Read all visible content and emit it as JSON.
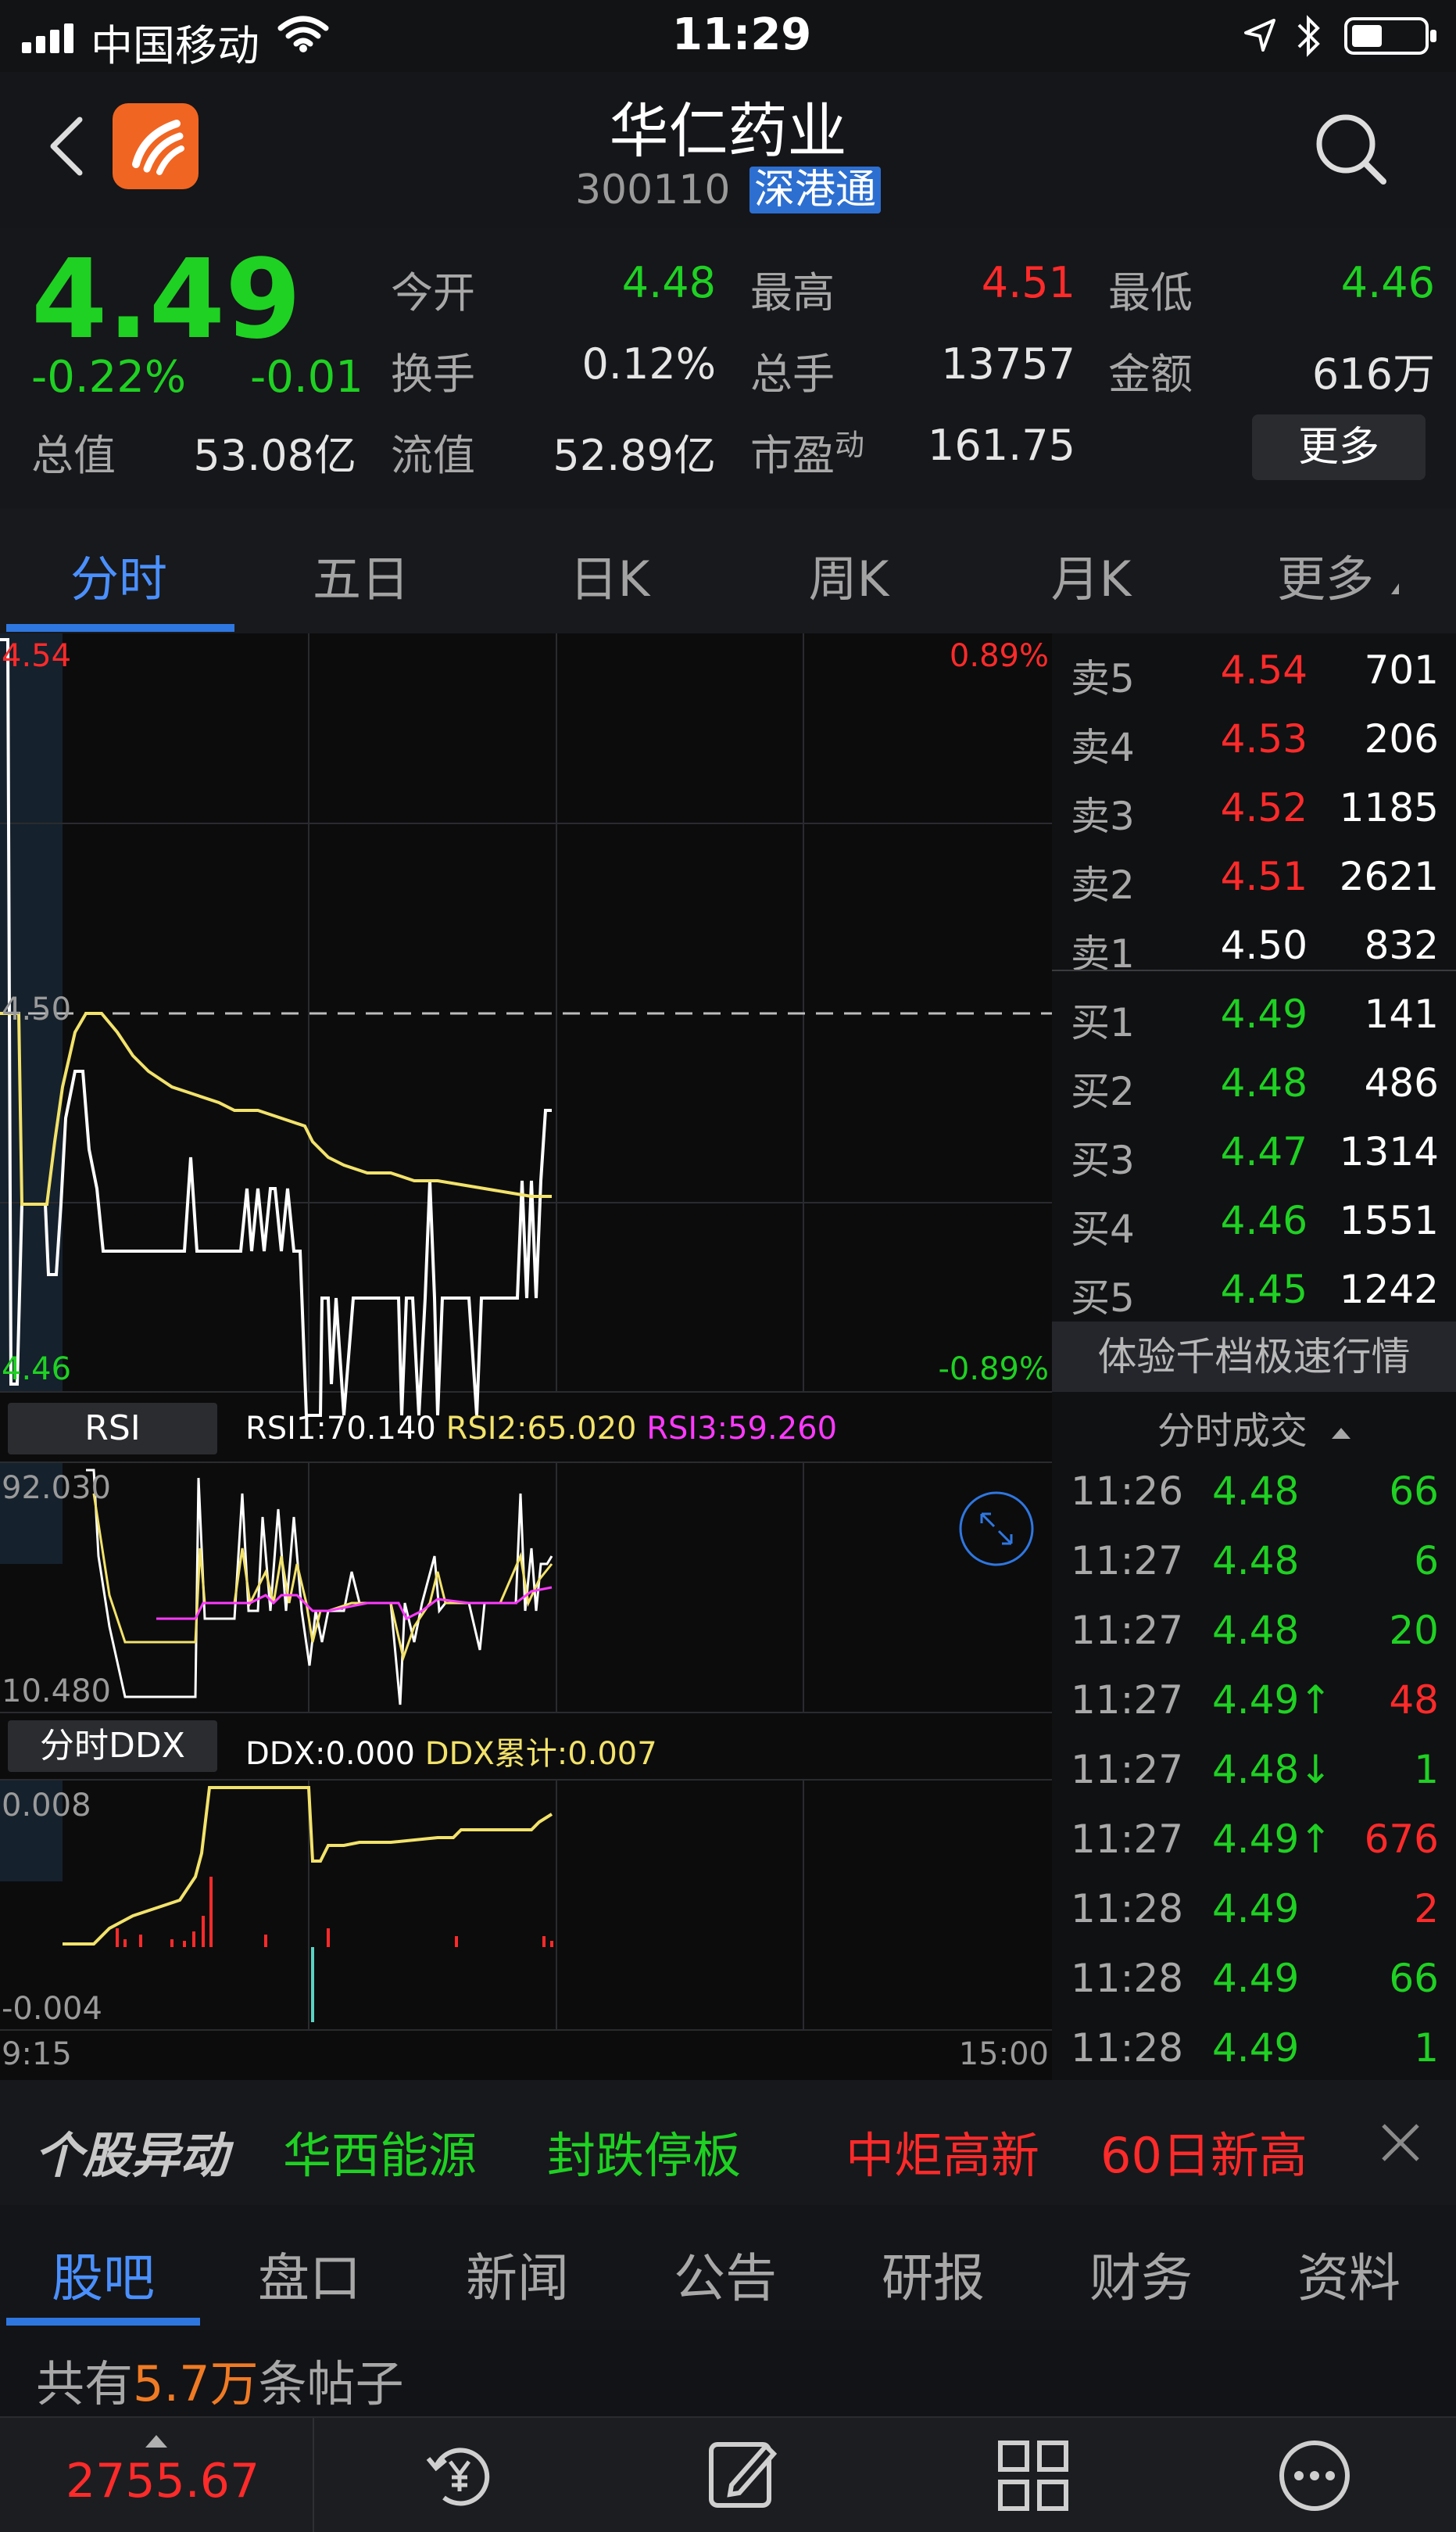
{
  "status_bar": {
    "carrier": "中国移动",
    "time": "11:29"
  },
  "header": {
    "title": "华仁药业",
    "code": "300110",
    "badge": "深港通"
  },
  "quote": {
    "price": "4.49",
    "change_pct": "-0.22%",
    "change": "-0.01",
    "open_label": "今开",
    "open": "4.48",
    "high_label": "最高",
    "high": "4.51",
    "low_label": "最低",
    "low": "4.46",
    "turnover_label": "换手",
    "turnover": "0.12%",
    "volume_label": "总手",
    "volume": "13757",
    "amount_label": "金额",
    "amount": "616万",
    "mktcap_label": "总值",
    "mktcap": "53.08亿",
    "float_label": "流值",
    "float": "52.89亿",
    "pe_label": "市盈",
    "pe_sup": "动",
    "pe": "161.75",
    "more_button": "更多"
  },
  "tabs": [
    {
      "label": "分时",
      "active": true
    },
    {
      "label": "五日"
    },
    {
      "label": "日K"
    },
    {
      "label": "周K"
    },
    {
      "label": "月K"
    },
    {
      "label": "更多"
    }
  ],
  "main_chart": {
    "y_max": "4.54",
    "y_mid": "4.50",
    "y_min": "4.46",
    "pct_max": "0.89%",
    "pct_min": "-0.89%",
    "t_start": "9:15",
    "t_end": "15:00"
  },
  "rsi": {
    "label": "RSI",
    "rsi1": "RSI1:70.140",
    "rsi2": "RSI2:65.020",
    "rsi3": "RSI3:59.260",
    "y_max": "92.030",
    "y_min": "10.480"
  },
  "ddx": {
    "label": "分时DDX",
    "ddx": "DDX:0.000",
    "ddx_sum": "DDX累计:0.007",
    "y_max": "0.008",
    "y_min": "-0.004"
  },
  "order_book": {
    "asks": [
      {
        "label": "卖5",
        "price": "4.54",
        "vol": "701",
        "color": "red"
      },
      {
        "label": "卖4",
        "price": "4.53",
        "vol": "206",
        "color": "red"
      },
      {
        "label": "卖3",
        "price": "4.52",
        "vol": "1185",
        "color": "red"
      },
      {
        "label": "卖2",
        "price": "4.51",
        "vol": "2621",
        "color": "red"
      },
      {
        "label": "卖1",
        "price": "4.50",
        "vol": "832",
        "color": "white"
      }
    ],
    "bids": [
      {
        "label": "买1",
        "price": "4.49",
        "vol": "141",
        "color": "green"
      },
      {
        "label": "买2",
        "price": "4.48",
        "vol": "486",
        "color": "green"
      },
      {
        "label": "买3",
        "price": "4.47",
        "vol": "1314",
        "color": "green"
      },
      {
        "label": "买4",
        "price": "4.46",
        "vol": "1551",
        "color": "green"
      },
      {
        "label": "买5",
        "price": "4.45",
        "vol": "1242",
        "color": "green"
      }
    ],
    "promo": "体验千档极速行情",
    "ticks_title": "分时成交"
  },
  "ticks": [
    {
      "time": "11:26",
      "price": "4.48",
      "vol": "66",
      "vcolor": "green"
    },
    {
      "time": "11:27",
      "price": "4.48",
      "vol": "6",
      "vcolor": "green"
    },
    {
      "time": "11:27",
      "price": "4.48",
      "vol": "20",
      "vcolor": "green"
    },
    {
      "time": "11:27",
      "price": "4.49↑",
      "vol": "48",
      "vcolor": "red"
    },
    {
      "time": "11:27",
      "price": "4.48↓",
      "vol": "1",
      "vcolor": "green"
    },
    {
      "time": "11:27",
      "price": "4.49↑",
      "vol": "676",
      "vcolor": "red"
    },
    {
      "time": "11:28",
      "price": "4.49",
      "vol": "2",
      "vcolor": "red"
    },
    {
      "time": "11:28",
      "price": "4.49",
      "vol": "66",
      "vcolor": "green"
    },
    {
      "time": "11:28",
      "price": "4.49",
      "vol": "1",
      "vcolor": "green"
    }
  ],
  "alert": {
    "title": "个股异动",
    "items": [
      {
        "text": "华西能源",
        "color": "green"
      },
      {
        "text": "封跌停板",
        "color": "green"
      },
      {
        "text": "中炬高新",
        "color": "red"
      },
      {
        "text": "60日新高",
        "color": "red"
      }
    ]
  },
  "bottom_tabs": [
    "股吧",
    "盘口",
    "新闻",
    "公告",
    "研报",
    "财务",
    "资料"
  ],
  "posts": {
    "prefix": "共有",
    "count": "5.7万",
    "suffix": "条帖子"
  },
  "tabbar": {
    "index_value": "2755.67"
  }
}
